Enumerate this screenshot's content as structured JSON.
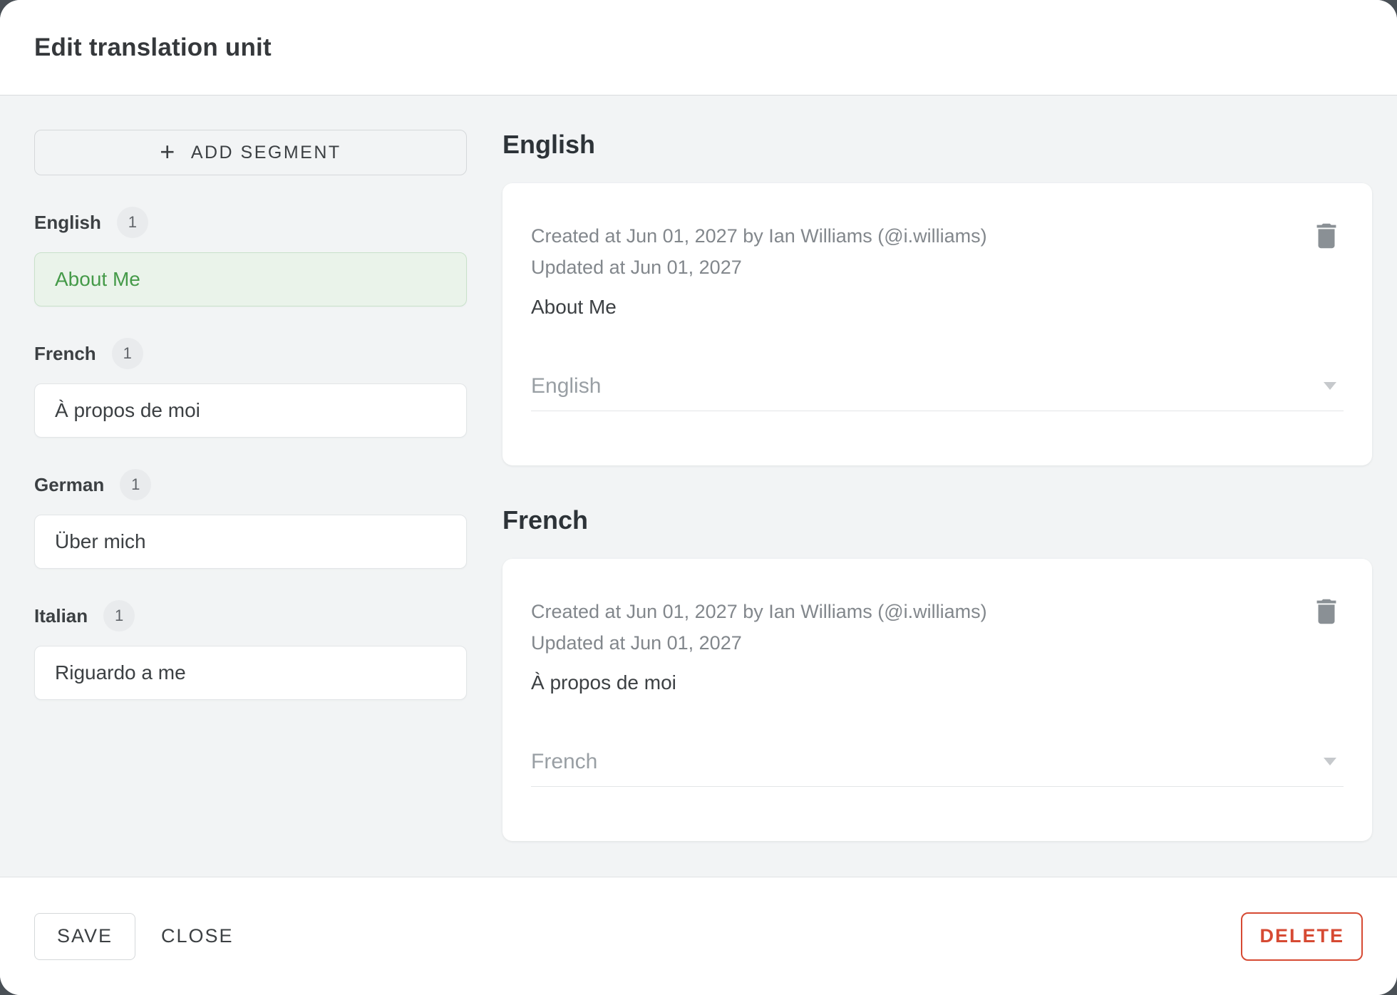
{
  "dialog": {
    "title": "Edit translation unit"
  },
  "sidebar": {
    "add_segment_label": "ADD SEGMENT",
    "groups": [
      {
        "language": "English",
        "count": "1",
        "value": "About Me",
        "active": true
      },
      {
        "language": "French",
        "count": "1",
        "value": "À propos de moi",
        "active": false
      },
      {
        "language": "German",
        "count": "1",
        "value": "Über mich",
        "active": false
      },
      {
        "language": "Italian",
        "count": "1",
        "value": "Riguardo a me",
        "active": false
      }
    ]
  },
  "main": {
    "sections": [
      {
        "heading": "English",
        "created": "Created at Jun 01, 2027 by Ian Williams (@i.williams)",
        "updated": "Updated at Jun 01, 2027",
        "text": "About Me",
        "language_select": "English"
      },
      {
        "heading": "French",
        "created": "Created at Jun 01, 2027 by Ian Williams (@i.williams)",
        "updated": "Updated at Jun 01, 2027",
        "text": "À propos de moi",
        "language_select": "French"
      }
    ]
  },
  "footer": {
    "save_label": "SAVE",
    "close_label": "CLOSE",
    "delete_label": "DELETE"
  },
  "icons": {
    "plus": "+"
  },
  "colors": {
    "accent_green_text": "#459a49",
    "accent_green_bg": "#eaf3ea",
    "accent_green_border": "#c9e1ca",
    "delete_red": "#d64a33",
    "backdrop": "#4a5056",
    "body_bg": "#f2f4f5",
    "trash_gray": "#8a9095"
  }
}
